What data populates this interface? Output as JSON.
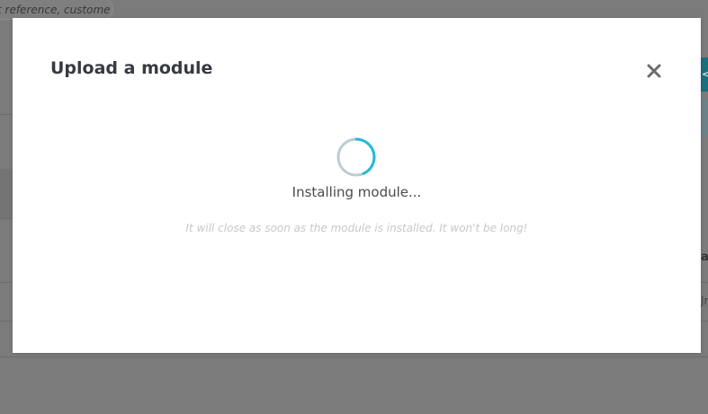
{
  "background": {
    "search_placeholder": "t reference, custome",
    "fragment_text_1": "al",
    "fragment_text_2": "Jr",
    "fragment_glyph": "<"
  },
  "modal": {
    "title": "Upload a module",
    "close_icon": "close-icon",
    "status_text": "Installing module...",
    "note_text": "It will close as soon as the module is installed. It won't be long!",
    "spinner_color": "#25b9d7",
    "spinner_track_color": "#bbcdd2"
  }
}
